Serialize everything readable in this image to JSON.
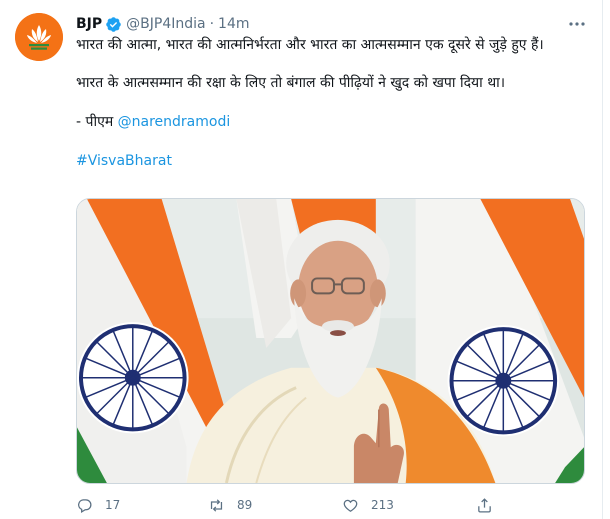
{
  "tweet": {
    "author": {
      "name": "BJP",
      "handle": "@BJP4India",
      "separator": "·",
      "time": "14m"
    },
    "text": {
      "p1": "भारत की आत्मा, भारत की आत्मनिर्भरता और भारत का आत्मसम्मान एक दूसरे से जुड़े हुए हैं।",
      "p2": "भारत के आत्मसम्मान की रक्षा के लिए तो बंगाल की पीढ़ियों ने खुद को खपा दिया था।",
      "p3_prefix": "- पीएम ",
      "p3_mention": "@narendramodi",
      "hashtag": "#VisvaBharat"
    },
    "stats": {
      "replies": "17",
      "retweets": "89",
      "likes": "213"
    }
  },
  "colors": {
    "accent": "#1b95e0",
    "muted": "#5b7083",
    "bjp_orange": "#f47216",
    "saffron": "#f26f21",
    "green": "#2e8b3d",
    "chakra_navy": "#1f2f72"
  },
  "icons": [
    "verified-badge-icon",
    "more-options-icon",
    "reply-icon",
    "retweet-icon",
    "like-icon",
    "share-icon",
    "bjp-lotus-logo-icon"
  ]
}
